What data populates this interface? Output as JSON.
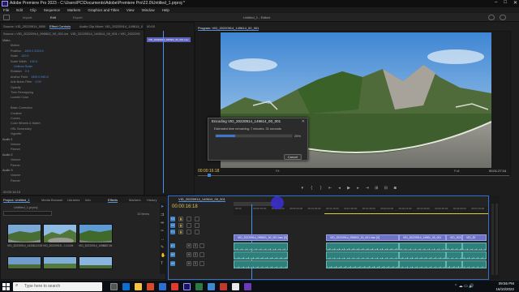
{
  "window": {
    "title": "Adobe Premiere Pro 2023 - C:\\Users\\PC\\Documents\\Adobe\\Premiere Pro\\22.0\\Untitled_1.prproj *",
    "controls": [
      "–",
      "□",
      "✕"
    ]
  },
  "menu": [
    "File",
    "Edit",
    "Clip",
    "Sequence",
    "Markers",
    "Graphics and Titles",
    "View",
    "Window",
    "Help"
  ],
  "workspace": {
    "tabs": [
      "Import",
      "Edit",
      "Export"
    ],
    "doc_title": "Untitled_1 - Edited"
  },
  "effect_controls": {
    "tabs": [
      "Source: VID_20220914_095601_00_001.insv",
      "Effect Controls",
      "Audio Clip Mixer: VID_20220914_149614_00_001"
    ],
    "source_line": "Source • VID_20220914_095602_00_001.insv",
    "clip_ref": "VID_20220914_149614_00_001 • VID_2022091",
    "rows": [
      {
        "label": "Video",
        "value": "",
        "header": true
      },
      {
        "label": "Motion",
        "value": "",
        "header": false
      },
      {
        "label": "Position",
        "value": "1920.0   1024.0",
        "header": false
      },
      {
        "label": "Scale",
        "value": "100.0",
        "header": false
      },
      {
        "label": "Scale Width",
        "value": "100.0",
        "header": false
      },
      {
        "label": "",
        "value": "Uniform Scale",
        "header": false
      },
      {
        "label": "Rotation",
        "value": "0.0",
        "header": false
      },
      {
        "label": "Anchor Point",
        "value": "1920.0   960.0",
        "header": false
      },
      {
        "label": "Anti-flicker Filter",
        "value": "0.00",
        "header": false
      },
      {
        "label": "Opacity",
        "value": "",
        "header": false
      },
      {
        "label": "Time Remapping",
        "value": "",
        "header": false
      },
      {
        "label": "Lumetri Color",
        "value": "",
        "header": false
      },
      {
        "label": "",
        "value": "",
        "header": false
      },
      {
        "label": "Basic Correction",
        "value": "",
        "header": false
      },
      {
        "label": "Creative",
        "value": "",
        "header": false
      },
      {
        "label": "Curves",
        "value": "",
        "header": false
      },
      {
        "label": "Color Wheels & Match",
        "value": "",
        "header": false
      },
      {
        "label": "HSL Secondary",
        "value": "",
        "header": false
      },
      {
        "label": "Vignette",
        "value": "",
        "header": false
      },
      {
        "label": "Audio 1",
        "value": "",
        "header": true
      },
      {
        "label": "Volume",
        "value": "",
        "header": false
      },
      {
        "label": "Panner",
        "value": "",
        "header": false
      },
      {
        "label": "Audio 2",
        "value": "",
        "header": true
      },
      {
        "label": "Volume",
        "value": "",
        "header": false
      },
      {
        "label": "Panner",
        "value": "",
        "header": false
      },
      {
        "label": "Audio 3",
        "value": "",
        "header": true
      },
      {
        "label": "Volume",
        "value": "",
        "header": false
      },
      {
        "label": "Panner",
        "value": "",
        "header": false
      }
    ],
    "timecode": "00:00:16:15"
  },
  "mini_timeline": {
    "clip": "VID_20220914_095602_00_001.insv",
    "start": "00:00"
  },
  "program": {
    "tab": "Program: VID_20220914_149614_00_001",
    "timecode_left": "00:00:16:18",
    "fit": "Fit",
    "quality": "Full",
    "timecode_right": "00:01:27:16"
  },
  "encode_dialog": {
    "title": "Encoding VID_20220914_149614_00_001",
    "message": "Estimated time remaining: 7 minutes, 31 seconds",
    "progress_pct": 25,
    "progress_label": "25%",
    "cancel": "Cancel"
  },
  "project": {
    "tabs": [
      "Project: Untitled_1",
      "Media Browser",
      "Libraries",
      "Info",
      "Effects",
      "Markers",
      "History"
    ],
    "name": "Untitled_1.prproj",
    "count": "10 items",
    "items": [
      {
        "label": "VID_20220914_14331...",
        "dur": "1:13:26"
      },
      {
        "label": "VID_20220915...",
        "dur": "1:14:26"
      },
      {
        "label": "VID_20220914_14961...",
        "dur": "1:27:16"
      }
    ]
  },
  "timeline": {
    "tab": "VID_20220914_149614_00_001",
    "timecode": "00:00:16:18",
    "ruler": [
      "00:00",
      "00:00:15:00",
      "00:00:30:00",
      "00:00:45:00",
      "00:01:00:00",
      "00:01:15:00",
      "00:01:30:00",
      "00:01:45:00",
      "00:02:00:00",
      "00:02:15:00",
      "00:02:30:00",
      "00:02:45:00",
      "00:03:00:00",
      "00:03:15:00"
    ],
    "video_tracks": [
      "V3",
      "V2",
      "V1"
    ],
    "audio_tracks": [
      "A1",
      "A2",
      "A3"
    ],
    "clips": {
      "v1a": "VID_20220914_095601_00_001.insv [V]",
      "v1b": "VID_20220914_095602_00_001.insv [V]",
      "v1c": "VID_20220914_14961_00_001",
      "v1d": "VID_2022",
      "v1e": "VID_20"
    }
  },
  "taskbar": {
    "search": "Type here to search",
    "time": "09:55 PM",
    "date": "16/10/2022"
  }
}
